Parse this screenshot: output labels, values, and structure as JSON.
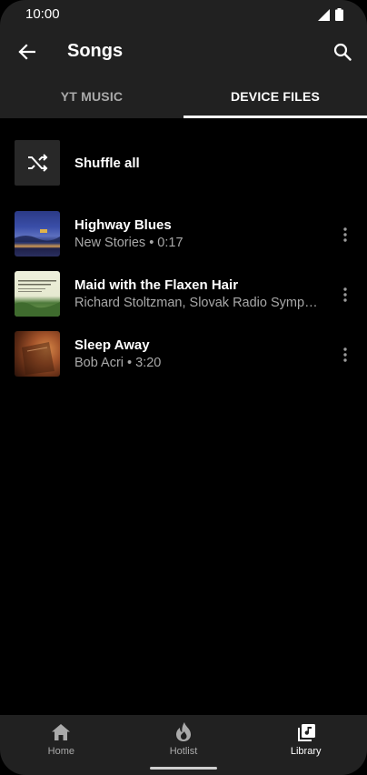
{
  "status": {
    "time": "10:00"
  },
  "header": {
    "title": "Songs"
  },
  "tabs": [
    {
      "label": "YT MUSIC",
      "active": false
    },
    {
      "label": "DEVICE FILES",
      "active": true
    }
  ],
  "shuffle": {
    "label": "Shuffle all"
  },
  "songs": [
    {
      "title": "Highway Blues",
      "subtitle": "New Stories • 0:17",
      "art": "album-art-highway-blues"
    },
    {
      "title": "Maid with the Flaxen Hair",
      "subtitle": "Richard Stoltzman, Slovak Radio Symph…",
      "art": "album-art-flaxen-hair"
    },
    {
      "title": "Sleep Away",
      "subtitle": "Bob Acri • 3:20",
      "art": "album-art-sleep-away"
    }
  ],
  "bottom_nav": [
    {
      "label": "Home",
      "icon": "home-icon",
      "active": false
    },
    {
      "label": "Hotlist",
      "icon": "flame-icon",
      "active": false
    },
    {
      "label": "Library",
      "icon": "library-music-icon",
      "active": true
    }
  ],
  "colors": {
    "background": "#000000",
    "surface": "#212121",
    "muted_text": "#a8a8a8"
  }
}
